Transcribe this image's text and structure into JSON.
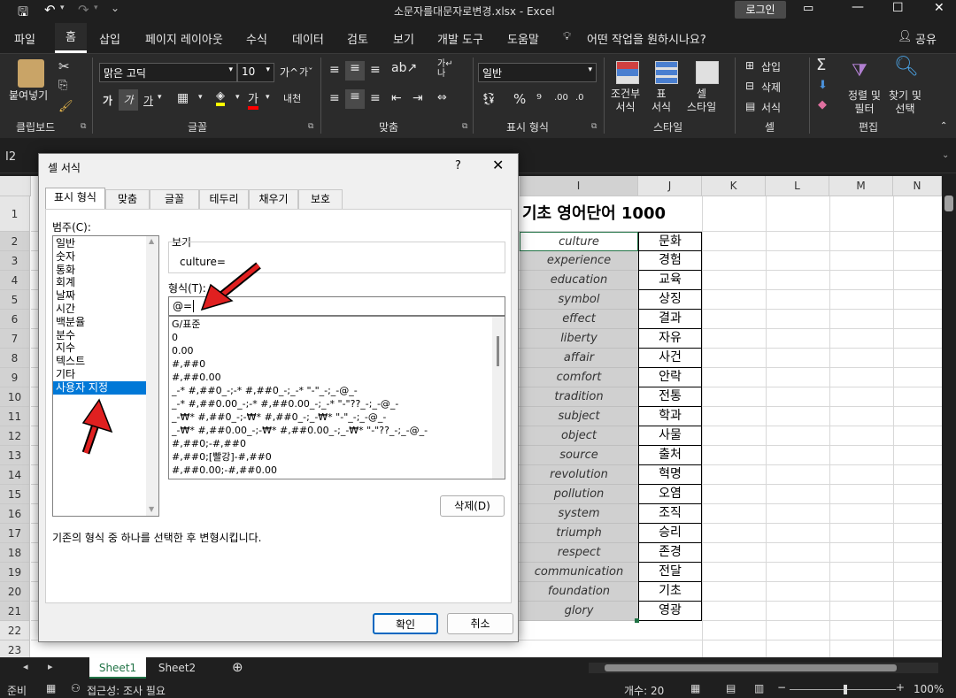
{
  "window": {
    "title": "소문자를대문자로변경.xlsx  -  Excel",
    "login": "로그인"
  },
  "ribbon_tabs": [
    "파일",
    "홈",
    "삽입",
    "페이지 레이아웃",
    "수식",
    "데이터",
    "검토",
    "보기",
    "개발 도구",
    "도움말"
  ],
  "active_tab": "홈",
  "tell_me": "어떤 작업을 원하시나요?",
  "share": "공유",
  "ribbon": {
    "paste": "붙여넣기",
    "font_name": "맑은 고딕",
    "font_size": "10",
    "number_format": "일반",
    "groups": {
      "clipboard": "클립보드",
      "font": "글꼴",
      "alignment": "맞춤",
      "number": "표시 형식",
      "styles": "스타일",
      "cells": "셀",
      "editing": "편집"
    },
    "conditional": "조건부\n서식",
    "table_fmt": "표\n서식",
    "cell_style": "셀\n스타일",
    "insert": "삽입",
    "delete": "삭제",
    "format": "서식",
    "sort_filter": "정렬 및\n필터",
    "find_select": "찾기 및\n선택"
  },
  "name_box": "I2",
  "columns": [
    "I",
    "J",
    "K",
    "L",
    "M",
    "N"
  ],
  "sheet": {
    "title": "기초 영어단어 1000",
    "rows": [
      {
        "en": "culture",
        "ko": "문화"
      },
      {
        "en": "experience",
        "ko": "경험"
      },
      {
        "en": "education",
        "ko": "교육"
      },
      {
        "en": "symbol",
        "ko": "상징"
      },
      {
        "en": "effect",
        "ko": "결과"
      },
      {
        "en": "liberty",
        "ko": "자유"
      },
      {
        "en": "affair",
        "ko": "사건"
      },
      {
        "en": "comfort",
        "ko": "안락"
      },
      {
        "en": "tradition",
        "ko": "전통"
      },
      {
        "en": "subject",
        "ko": "학과"
      },
      {
        "en": "object",
        "ko": "사물"
      },
      {
        "en": "source",
        "ko": "출처"
      },
      {
        "en": "revolution",
        "ko": "혁명"
      },
      {
        "en": "pollution",
        "ko": "오염"
      },
      {
        "en": "system",
        "ko": "조직"
      },
      {
        "en": "triumph",
        "ko": "승리"
      },
      {
        "en": "respect",
        "ko": "존경"
      },
      {
        "en": "communication",
        "ko": "전달"
      },
      {
        "en": "foundation",
        "ko": "기초"
      },
      {
        "en": "glory",
        "ko": "영광"
      }
    ],
    "row_numbers": [
      "1",
      "2",
      "3",
      "4",
      "5",
      "6",
      "7",
      "8",
      "9",
      "10",
      "11",
      "12",
      "13",
      "14",
      "15",
      "16",
      "17",
      "18",
      "19",
      "20",
      "21",
      "22",
      "23"
    ]
  },
  "sheet_tabs": [
    "Sheet1",
    "Sheet2"
  ],
  "status": {
    "ready": "준비",
    "accessibility": "접근성: 조사 필요",
    "count": "개수: 20",
    "zoom": "100%"
  },
  "dialog": {
    "title": "셀 서식",
    "help": "?",
    "tabs": [
      "표시 형식",
      "맞춤",
      "글꼴",
      "테두리",
      "채우기",
      "보호"
    ],
    "category_label": "범주(C):",
    "categories": [
      "일반",
      "숫자",
      "통화",
      "회계",
      "날짜",
      "시간",
      "백분율",
      "분수",
      "지수",
      "텍스트",
      "기타",
      "사용자 지정"
    ],
    "selected_category": "사용자 지정",
    "sample_label": "보기",
    "sample_value": "culture=",
    "type_label": "형식(T):",
    "type_value": "@=",
    "formats": [
      "G/표준",
      "0",
      "0.00",
      "#,##0",
      "#,##0.00",
      "_-* #,##0_-;-* #,##0_-;_-* \"-\"_-;_-@_-",
      "_-* #,##0.00_-;-* #,##0.00_-;_-* \"-\"??_-;_-@_-",
      "_-₩* #,##0_-;-₩* #,##0_-;_-₩* \"-\"_-;_-@_-",
      "_-₩* #,##0.00_-;-₩* #,##0.00_-;_-₩* \"-\"??_-;_-@_-",
      "#,##0;-#,##0",
      "#,##0;[빨강]-#,##0",
      "#,##0.00;-#,##0.00"
    ],
    "delete_btn": "삭제(D)",
    "description": "기존의 형식 중 하나를 선택한 후 변형시킵니다.",
    "ok": "확인",
    "cancel": "취소"
  }
}
